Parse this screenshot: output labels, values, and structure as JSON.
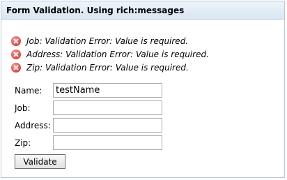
{
  "panel": {
    "title": "Form Validation. Using rich:messages"
  },
  "messages": [
    {
      "icon": "error-icon",
      "text": "Job: Validation Error: Value is required."
    },
    {
      "icon": "error-icon",
      "text": "Address: Validation Error: Value is required."
    },
    {
      "icon": "error-icon",
      "text": "Zip: Validation Error: Value is required."
    }
  ],
  "form": {
    "fields": [
      {
        "label": "Name:",
        "value": "testName"
      },
      {
        "label": "Job:",
        "value": ""
      },
      {
        "label": "Address:",
        "value": ""
      },
      {
        "label": "Zip:",
        "value": ""
      }
    ],
    "submit_label": "Validate"
  },
  "colors": {
    "error": "#d9463f",
    "header_border": "#b8c8d8"
  }
}
